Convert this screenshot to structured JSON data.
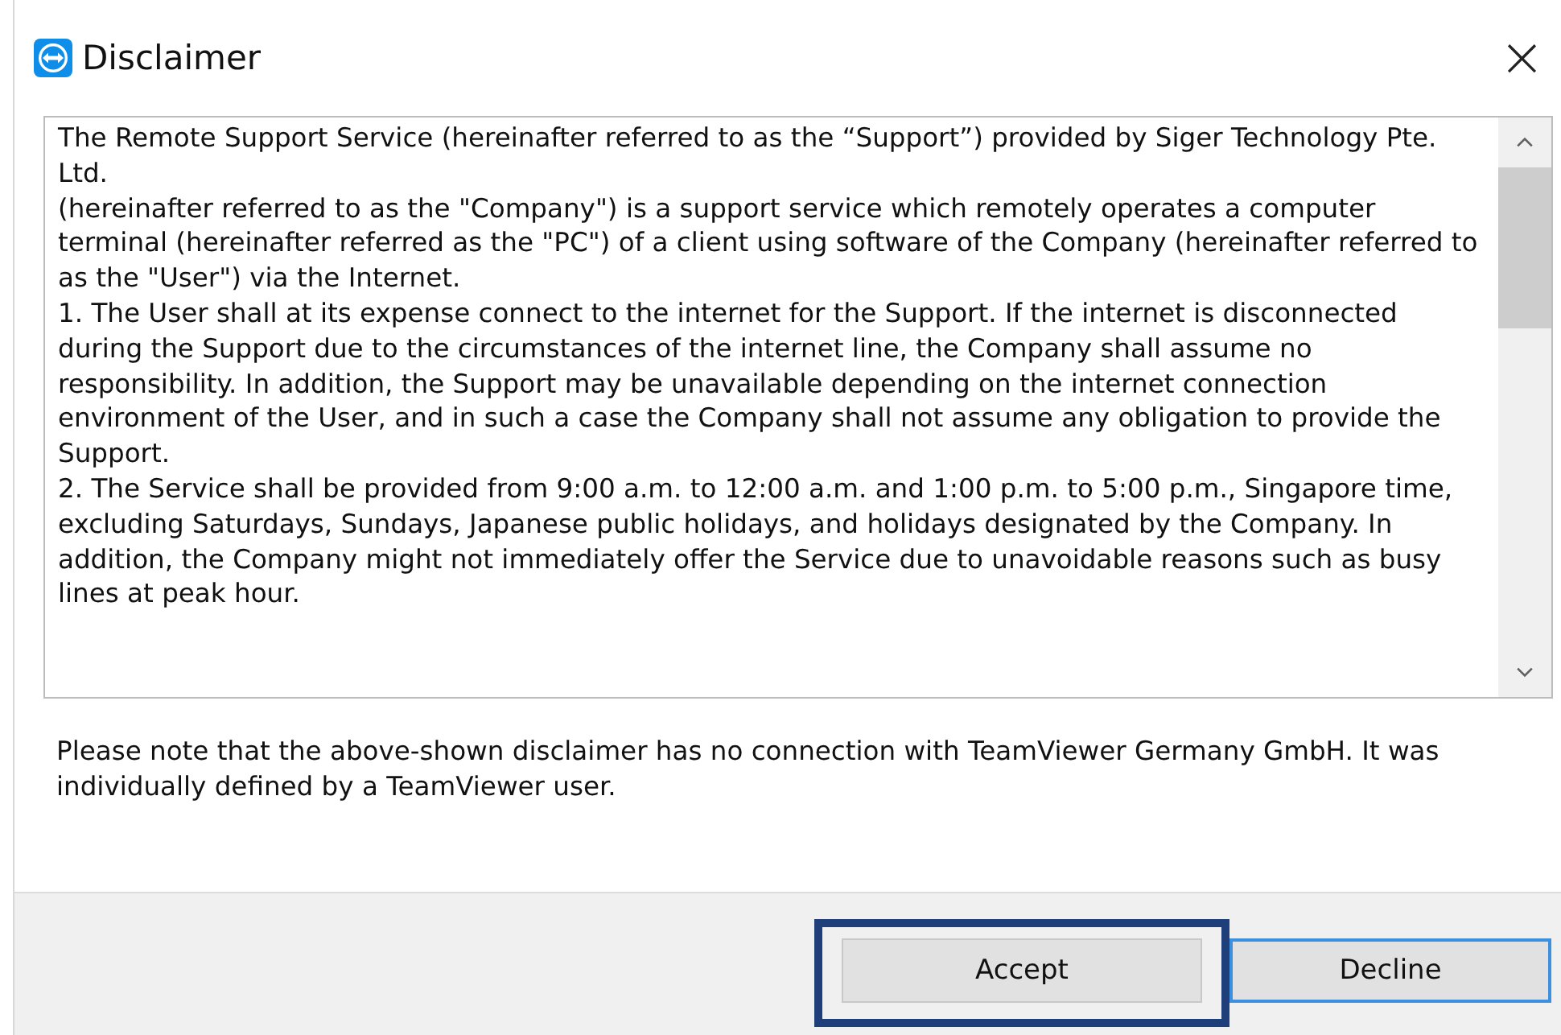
{
  "window": {
    "title": "Disclaimer",
    "close": "×"
  },
  "disclaimer_text": [
    "The Remote Support Service (hereinafter referred to as the “Support”) provided by Siger Technology Pte. Ltd.",
    "(hereinafter referred to as the \"Company\") is a support service which remotely operates a computer terminal (hereinafter referred as the \"PC\") of a client using software of the Company (hereinafter referred to as the \"User\") via the Internet.",
    "1. The User shall at its expense connect to the internet for the Support. If the internet is disconnected during the Support due to the circumstances of the internet line, the Company shall assume no responsibility. In addition, the Support may be unavailable depending on the internet connection environment of the User, and in such a case the Company shall not assume any obligation to provide the Support.",
    "2. The Service shall be provided from 9:00 a.m. to 12:00 a.m. and 1:00 p.m. to 5:00 p.m., Singapore time, excluding Saturdays, Sundays, Japanese public holidays, and holidays designated by the Company. In addition, the Company might not immediately offer the Service due to unavoidable reasons such as busy lines at peak hour."
  ],
  "note": "Please note that the above-shown disclaimer has no connection with TeamViewer Germany GmbH. It was individually defined by a TeamViewer user.",
  "buttons": [
    {
      "label": "Accept",
      "highlighted": true,
      "default": false
    },
    {
      "label": "Decline",
      "highlighted": false,
      "default": true
    }
  ]
}
